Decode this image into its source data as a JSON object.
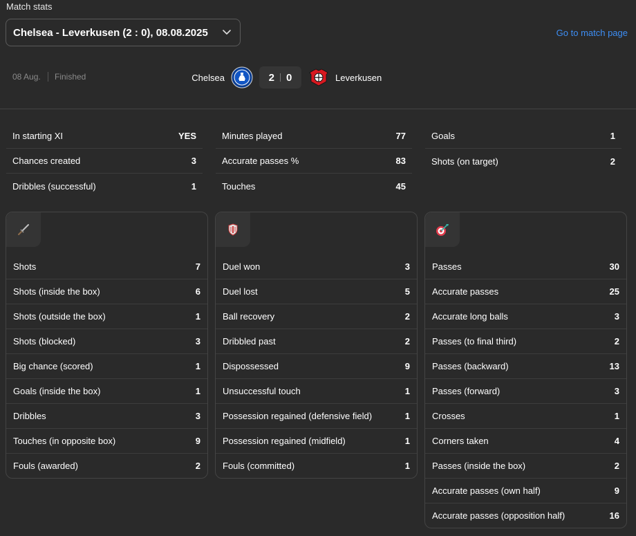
{
  "header": {
    "section_title": "Match stats",
    "match_select_value": "Chelsea - Leverkusen (2 : 0), 08.08.2025",
    "go_to_match_label": "Go to match page"
  },
  "match": {
    "date": "08 Aug.",
    "status": "Finished",
    "home_team": "Chelsea",
    "away_team": "Leverkusen",
    "home_score": "2",
    "away_score": "0"
  },
  "summary": [
    [
      {
        "label": "In starting XI",
        "value": "YES"
      },
      {
        "label": "Chances created",
        "value": "3"
      },
      {
        "label": "Dribbles (successful)",
        "value": "1"
      }
    ],
    [
      {
        "label": "Minutes played",
        "value": "77"
      },
      {
        "label": "Accurate passes %",
        "value": "83"
      },
      {
        "label": "Touches",
        "value": "45"
      }
    ],
    [
      {
        "label": "Goals",
        "value": "1"
      },
      {
        "label": "Shots (on target)",
        "value": "2"
      }
    ]
  ],
  "cards": [
    {
      "icon": "sword-icon",
      "rows": [
        {
          "label": "Shots",
          "value": "7"
        },
        {
          "label": "Shots (inside the box)",
          "value": "6"
        },
        {
          "label": "Shots (outside the box)",
          "value": "1"
        },
        {
          "label": "Shots (blocked)",
          "value": "3"
        },
        {
          "label": "Big chance (scored)",
          "value": "1"
        },
        {
          "label": "Goals (inside the box)",
          "value": "1"
        },
        {
          "label": "Dribbles",
          "value": "3"
        },
        {
          "label": "Touches (in opposite box)",
          "value": "9"
        },
        {
          "label": "Fouls (awarded)",
          "value": "2"
        }
      ]
    },
    {
      "icon": "shield-icon",
      "rows": [
        {
          "label": "Duel won",
          "value": "3"
        },
        {
          "label": "Duel lost",
          "value": "5"
        },
        {
          "label": "Ball recovery",
          "value": "2"
        },
        {
          "label": "Dribbled past",
          "value": "2"
        },
        {
          "label": "Dispossessed",
          "value": "9"
        },
        {
          "label": "Unsuccessful touch",
          "value": "1"
        },
        {
          "label": "Possession regained (defensive field)",
          "value": "1"
        },
        {
          "label": "Possession regained (midfield)",
          "value": "1"
        },
        {
          "label": "Fouls (committed)",
          "value": "1"
        }
      ]
    },
    {
      "icon": "target-icon",
      "rows": [
        {
          "label": "Passes",
          "value": "30"
        },
        {
          "label": "Accurate passes",
          "value": "25"
        },
        {
          "label": "Accurate long balls",
          "value": "3"
        },
        {
          "label": "Passes (to final third)",
          "value": "2"
        },
        {
          "label": "Passes (backward)",
          "value": "13"
        },
        {
          "label": "Passes (forward)",
          "value": "3"
        },
        {
          "label": "Crosses",
          "value": "1"
        },
        {
          "label": "Corners taken",
          "value": "4"
        },
        {
          "label": "Passes (inside the box)",
          "value": "2"
        },
        {
          "label": "Accurate passes (own half)",
          "value": "9"
        },
        {
          "label": "Accurate passes (opposition half)",
          "value": "16"
        }
      ]
    }
  ]
}
